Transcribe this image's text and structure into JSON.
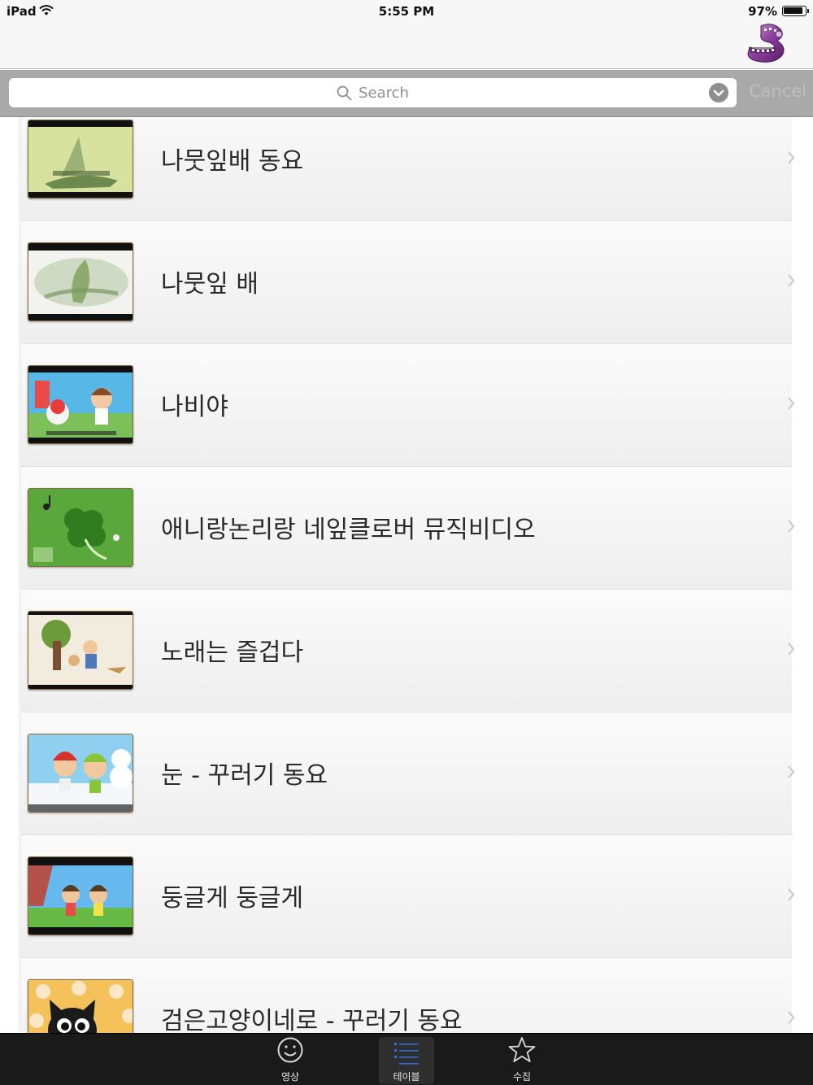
{
  "status_bar": {
    "device": "iPad",
    "time": "5:55 PM",
    "battery_text": "97%",
    "battery_level": 0.97
  },
  "nav_bar": {
    "logo_icon": "film-reel-icon"
  },
  "search": {
    "placeholder": "Search",
    "cancel_label": "Cancel"
  },
  "list": {
    "items": [
      {
        "title": "나뭇잎배 동요",
        "thumb": "leaf-boat"
      },
      {
        "title": "나뭇잎 배",
        "thumb": "leaf"
      },
      {
        "title": "나비야",
        "thumb": "cartoon-park"
      },
      {
        "title": "애니랑논리랑 네잎클로버 뮤직비디오",
        "thumb": "clover"
      },
      {
        "title": "노래는 즐겁다",
        "thumb": "tree-kids"
      },
      {
        "title": "눈 - 꾸러기 동요",
        "thumb": "snow-kids"
      },
      {
        "title": "둥글게 둥글게",
        "thumb": "dancing-kids"
      },
      {
        "title": "검은고양이네로 - 꾸러기 동요",
        "thumb": "black-cat"
      }
    ]
  },
  "tab_bar": {
    "tabs": [
      {
        "label": "영상",
        "icon": "smiley-icon"
      },
      {
        "label": "테이블",
        "icon": "list-icon",
        "selected": true
      },
      {
        "label": "수집",
        "icon": "star-icon"
      }
    ]
  },
  "colors": {
    "search_bar_bg": "#a9a9a9",
    "tab_bar_bg": "#1a1a1a",
    "selected_tab_bg": "#2e2e2e",
    "tab_icon_blue": "#2f6fe0"
  }
}
